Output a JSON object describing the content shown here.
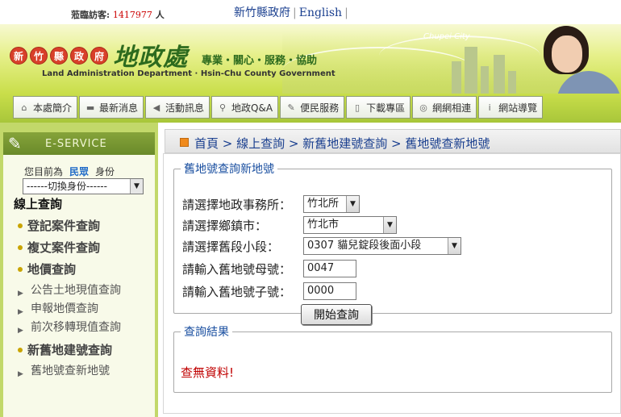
{
  "header": {
    "visitor_label": "蒞臨訪客:",
    "visitor_count": "1417977",
    "visitor_unit": "人",
    "links": [
      "新竹縣政府",
      "English"
    ],
    "county_chars": [
      "新",
      "竹",
      "縣",
      "政",
      "府"
    ],
    "dept_title": "地政處",
    "slogan": "專業・關心・服務・協助",
    "dept_en": "Land Administration Department · Hsin-Chu County Government",
    "map_label": "Chupei City",
    "brand_color": "#c9de4a"
  },
  "nav": {
    "items": [
      {
        "label": "本處簡介",
        "icon": "home-icon",
        "glyph": "⌂"
      },
      {
        "label": "最新消息",
        "icon": "folder-icon",
        "glyph": "▬"
      },
      {
        "label": "活動訊息",
        "icon": "speaker-icon",
        "glyph": "◀"
      },
      {
        "label": "地政Q&A",
        "icon": "magnifier-icon",
        "glyph": "⚲"
      },
      {
        "label": "便民服務",
        "icon": "pencil-icon",
        "glyph": "✎"
      },
      {
        "label": "下載專區",
        "icon": "download-icon",
        "glyph": "▯"
      },
      {
        "label": "網網相連",
        "icon": "globe-icon",
        "glyph": "◎"
      },
      {
        "label": "網站導覽",
        "icon": "info-icon",
        "glyph": "i"
      }
    ]
  },
  "sidebar": {
    "eservice": "E-SERVICE",
    "identity_prefix": "您目前為",
    "identity_role": "民眾",
    "identity_suffix": "身份",
    "identity_select": "------切換身份------",
    "heading": "線上查詢",
    "menu": [
      {
        "level": 1,
        "label": "登記案件查詢"
      },
      {
        "level": 1,
        "label": "複丈案件查詢"
      },
      {
        "level": 1,
        "label": "地價查詢"
      },
      {
        "level": 2,
        "label": "公告土地現值查詢"
      },
      {
        "level": 2,
        "label": "申報地價查詢"
      },
      {
        "level": 2,
        "label": "前次移轉現值查詢"
      },
      {
        "level": 1,
        "label": "新舊地建號查詢"
      },
      {
        "level": 2,
        "label": "舊地號查新地號"
      }
    ]
  },
  "main": {
    "breadcrumb": "首頁 > 線上查詢 > 新舊地建號查詢 > 舊地號查新地號",
    "form": {
      "legend": "舊地號查詢新地號",
      "office_label": "請選擇地政事務所：",
      "office_value": "竹北所",
      "township_label": "請選擇鄉鎮市：",
      "township_value": "竹北市",
      "section_label": "請選擇舊段小段：",
      "section_value": "0307 貓兒錠段後面小段",
      "parent_label": "請輸入舊地號母號：",
      "parent_value": "0047",
      "child_label": "請輸入舊地號子號：",
      "child_value": "0000",
      "submit": "開始查詢"
    },
    "result": {
      "legend": "查詢結果",
      "message": "查無資料!"
    }
  }
}
